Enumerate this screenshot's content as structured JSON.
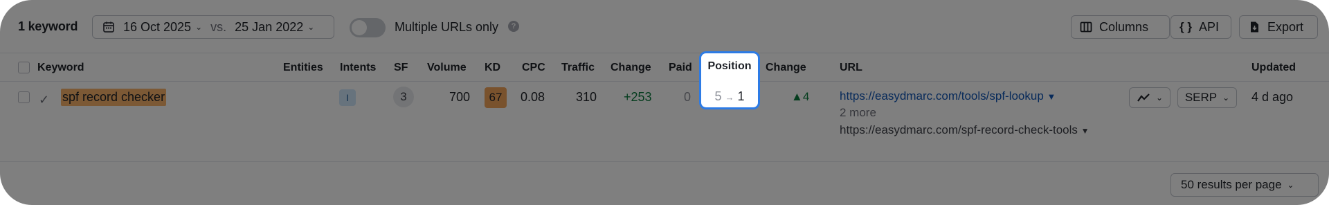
{
  "toolbar": {
    "keyword_count": "1 keyword",
    "date_current": "16 Oct 2025",
    "vs_label": "vs.",
    "date_compare": "25 Jan 2022",
    "toggle_label": "Multiple URLs only",
    "toggle_on": false,
    "help_glyph": "?",
    "columns_label": "Columns",
    "api_label": "API",
    "api_icon_text": "{ }",
    "export_label": "Export"
  },
  "table": {
    "headers": {
      "keyword": "Keyword",
      "entities": "Entities",
      "intents": "Intents",
      "sf": "SF",
      "volume": "Volume",
      "kd": "KD",
      "cpc": "CPC",
      "traffic": "Traffic",
      "change": "Change",
      "paid": "Paid",
      "position": "Position",
      "position_change": "Change",
      "url": "URL",
      "updated": "Updated"
    },
    "rows": [
      {
        "keyword": "spf record checker",
        "intent": "I",
        "sf": "3",
        "volume": "700",
        "kd": "67",
        "cpc": "0.08",
        "traffic": "310",
        "change": "+253",
        "paid": "0",
        "position_from": "5",
        "position_to": "1",
        "position_change": "▲4",
        "url": "https://easydmarc.com/tools/spf-lookup",
        "more": "2 more",
        "url2": "https://easydmarc.com/spf-record-check-tools",
        "serp_label": "SERP",
        "updated": "4 d ago"
      }
    ]
  },
  "footer": {
    "per_page": "50 results per page"
  },
  "icons": {
    "calendar": "calendar-icon",
    "columns": "columns-icon",
    "api": "api-icon",
    "export": "export-icon",
    "check": "check-icon",
    "chart": "chart-icon",
    "chevron": "chevron-down-icon"
  },
  "colors": {
    "keyword_highlight": "#f8b26a",
    "kd_badge": "#f3a45a",
    "positive_change": "#0a7a3d",
    "link": "#0f54b5",
    "focus_border": "#2d7be5"
  }
}
